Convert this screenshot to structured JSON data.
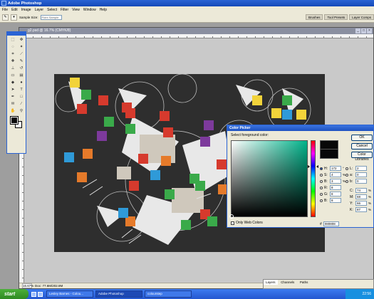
{
  "app": {
    "title": "Adobe Photoshop"
  },
  "menu": [
    "File",
    "Edit",
    "Image",
    "Layer",
    "Select",
    "Filter",
    "View",
    "Window",
    "Help"
  ],
  "options_bar": {
    "sample_size_label": "Sample Size:",
    "sample_size_value": "Point Sample"
  },
  "palette_well": [
    "Brushes",
    "Tool Presets",
    "Layer Comps"
  ],
  "document": {
    "title": "g2.psd @ 16.7% (CMYK/8)",
    "status_zoom": "16.67%",
    "status_doc": "Doc: 77.6M/202.8M"
  },
  "color_picker": {
    "title": "Color Picker",
    "prompt": "Select foreground color:",
    "buttons": [
      "OK",
      "Cancel",
      "Color Libraries"
    ],
    "hsb": [
      {
        "label": "H:",
        "value": "172",
        "unit": "°"
      },
      {
        "label": "S:",
        "value": "4",
        "unit": "%"
      },
      {
        "label": "B:",
        "value": "3",
        "unit": "%"
      }
    ],
    "rgb": [
      {
        "label": "R:",
        "value": "8"
      },
      {
        "label": "G:",
        "value": "8"
      },
      {
        "label": "B:",
        "value": "8"
      }
    ],
    "lab": [
      {
        "label": "L:",
        "value": "2"
      },
      {
        "label": "a:",
        "value": "0"
      },
      {
        "label": "b:",
        "value": "0"
      }
    ],
    "cmyk": [
      {
        "label": "C:",
        "value": "74",
        "unit": "%"
      },
      {
        "label": "M:",
        "value": "68",
        "unit": "%"
      },
      {
        "label": "Y:",
        "value": "66",
        "unit": "%"
      },
      {
        "label": "K:",
        "value": "87",
        "unit": "%"
      }
    ],
    "hex_label": "#",
    "hex": "080808",
    "web_only": "Only Web Colors",
    "current_color": "#080808"
  },
  "layers_panel": {
    "tabs": [
      "Layers",
      "Channels",
      "Paths"
    ]
  },
  "taskbar": {
    "start": "start",
    "tasks": [
      "Lesley Barnes - Colou...",
      "Adobe Photoshop",
      "colourstep"
    ],
    "clock": "22:56"
  },
  "colors": {
    "title_blue": "#2a63d4",
    "chrome": "#ece9d8",
    "canvas_bg": "#2e2e2e"
  }
}
